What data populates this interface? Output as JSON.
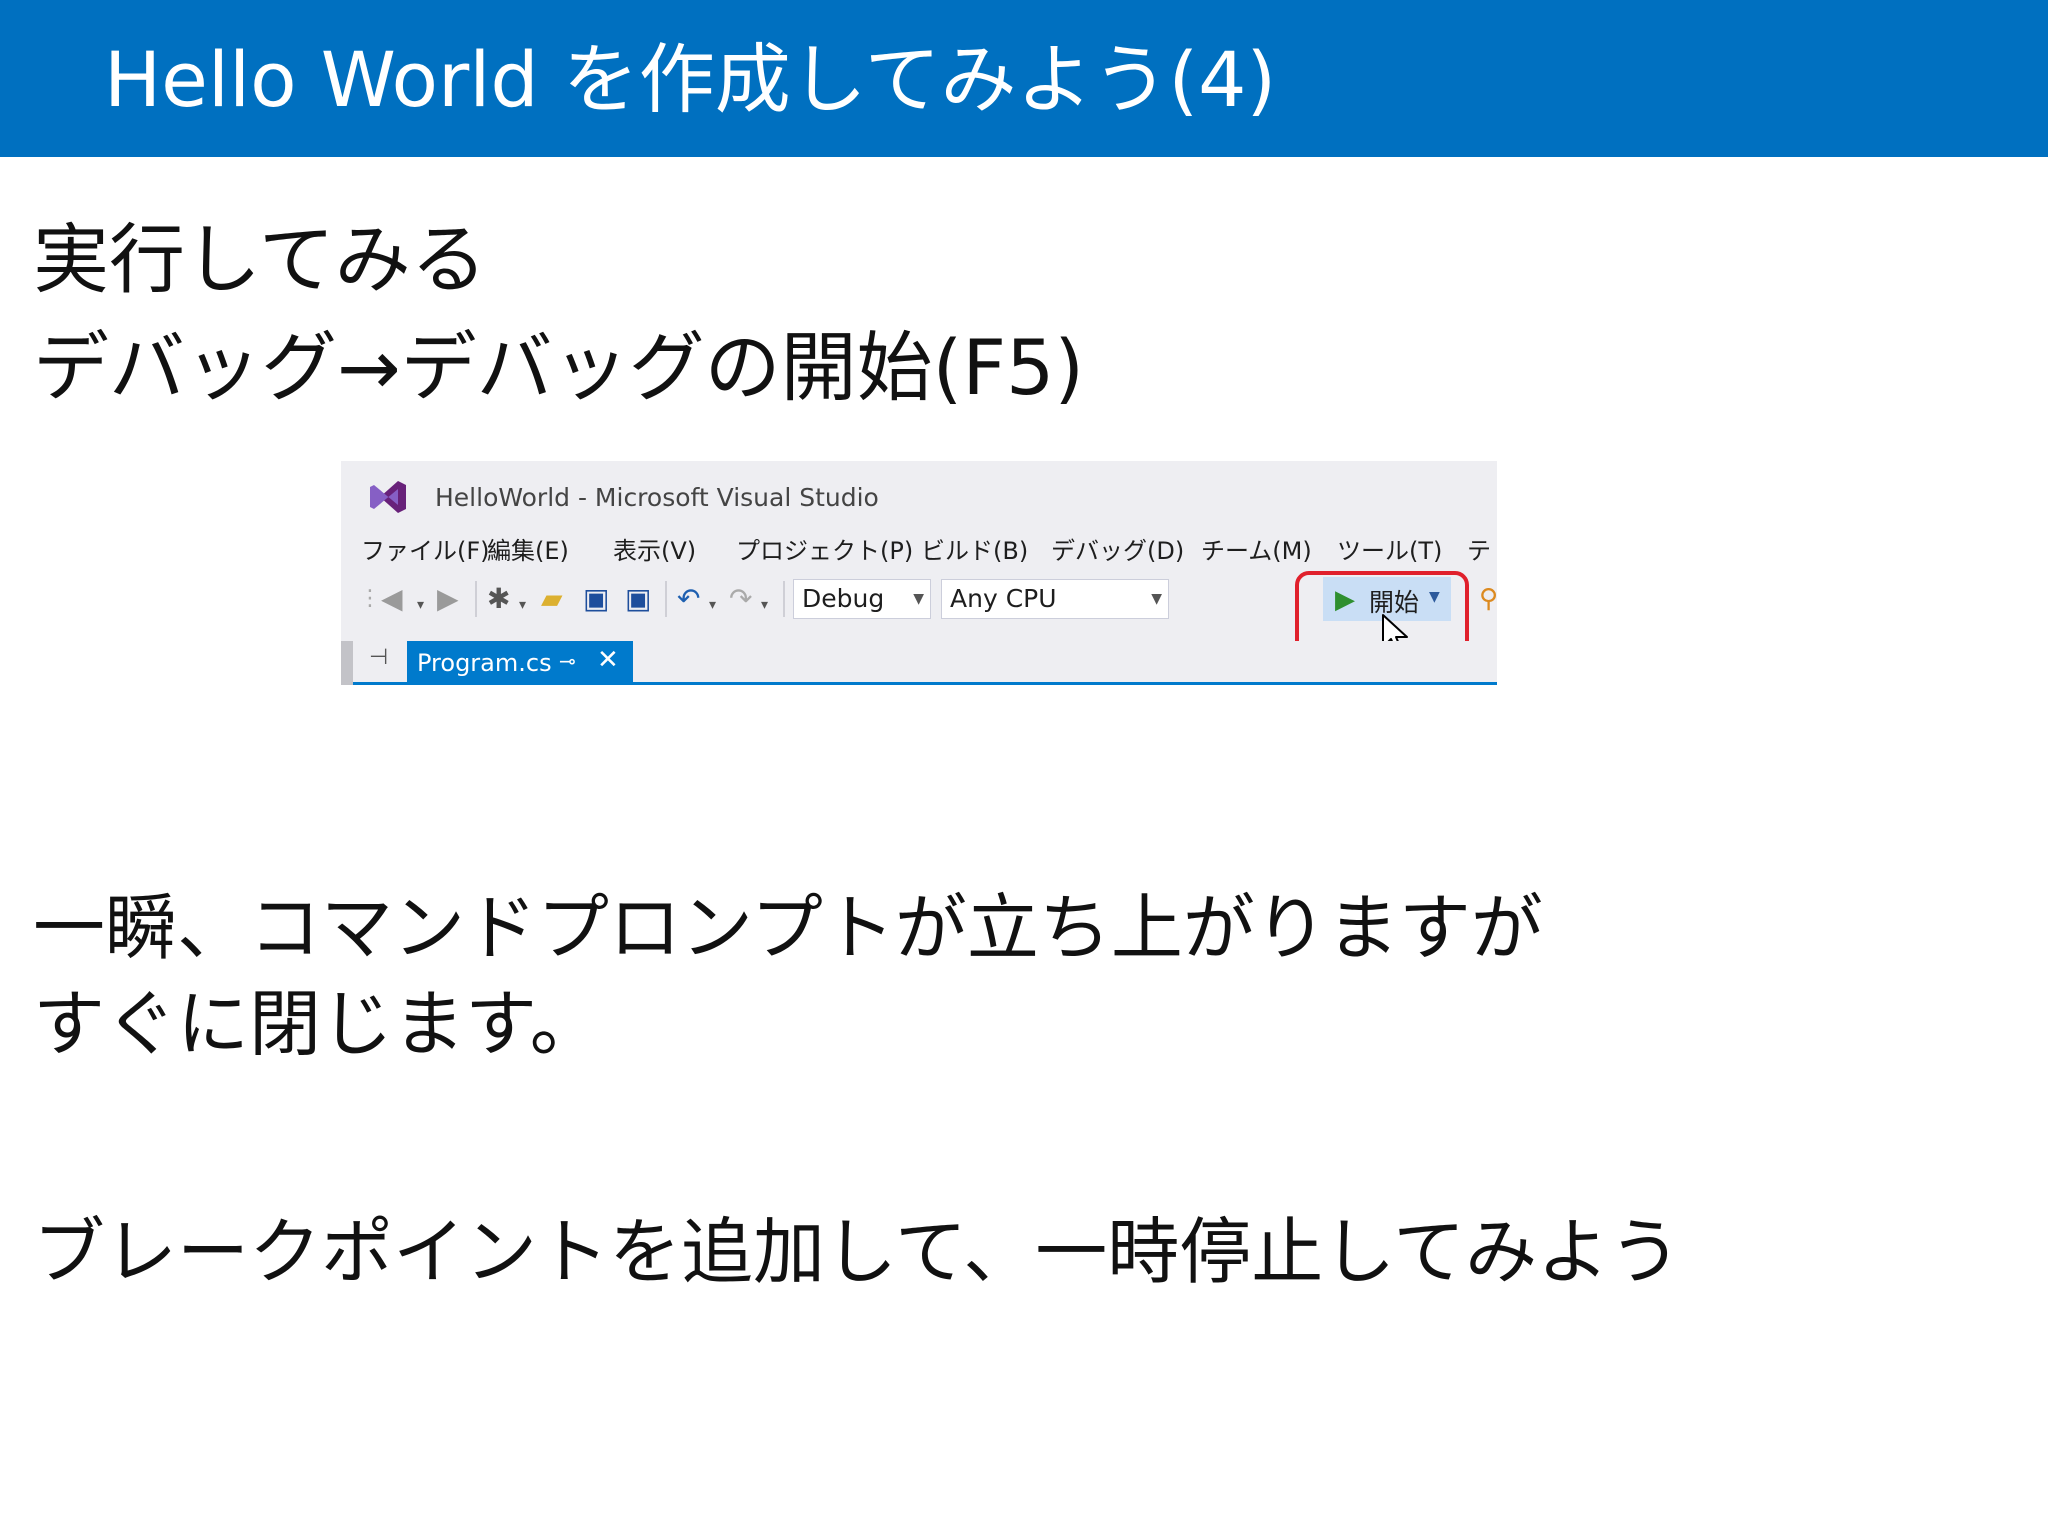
{
  "slide": {
    "title": "Hello World を作成してみよう(4)",
    "line1": "実行してみる",
    "line2": "デバッグ→デバッグの開始(F5)",
    "line3": "一瞬、コマンドプロンプトが立ち上がりますが",
    "line4": "すぐに閉じます。",
    "line5": "ブレークポイントを追加して、一時停止してみよう",
    "accent_color": "#0070c0"
  },
  "vs": {
    "window_title": "HelloWorld - Microsoft Visual Studio",
    "menu": [
      "ファイル(F)",
      "編集(E)",
      "表示(V)",
      "プロジェクト(P)",
      "ビルド(B)",
      "デバッグ(D)",
      "チーム(M)",
      "ツール(T)",
      "テ"
    ],
    "config_value": "Debug",
    "platform_value": "Any CPU",
    "start_label": "開始",
    "highlight_color": "#e0202c",
    "tab_label": "Program.cs",
    "icons": [
      "visual-studio-logo-icon",
      "back-icon",
      "forward-icon",
      "new-project-icon",
      "open-folder-icon",
      "save-icon",
      "save-all-icon",
      "undo-icon",
      "redo-icon",
      "play-icon",
      "pin-icon",
      "close-icon",
      "mouse-cursor-icon"
    ]
  }
}
